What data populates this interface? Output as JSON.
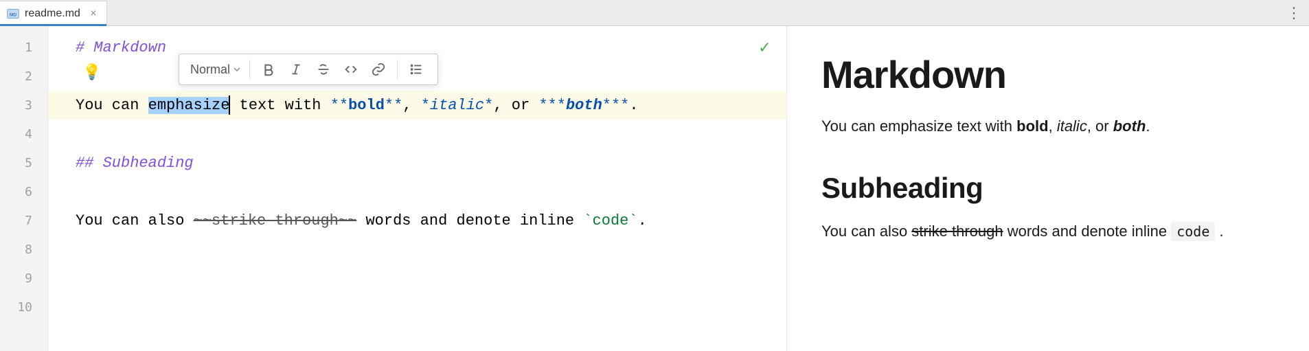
{
  "tab": {
    "filename": "readme.md",
    "icon": "markdown-file-icon"
  },
  "gutter": {
    "lines": [
      "1",
      "2",
      "3",
      "4",
      "5",
      "6",
      "7",
      "8",
      "9",
      "10"
    ]
  },
  "editor": {
    "line1": "# Markdown",
    "line3_prefix": "You can ",
    "line3_selected": "emphasize",
    "line3_mid1": " text with ",
    "line3_bold_sym1": "**",
    "line3_bold_text": "bold",
    "line3_bold_sym2": "**",
    "line3_comma1": ", ",
    "line3_ital_sym1": "*",
    "line3_ital_text": "italic",
    "line3_ital_sym2": "*",
    "line3_comma2": ", or ",
    "line3_both_sym1": "***",
    "line3_both_text": "both",
    "line3_both_sym2": "***",
    "line3_period": ".",
    "line5": "## Subheading",
    "line7_prefix": "You can also ",
    "line7_strike": "~~strike through~~",
    "line7_mid": " words and denote inline ",
    "line7_code": "`code`",
    "line7_period": "."
  },
  "toolbar": {
    "style_label": "Normal"
  },
  "preview": {
    "h1": "Markdown",
    "p1_a": "You can emphasize text with ",
    "p1_bold": "bold",
    "p1_b": ", ",
    "p1_italic": "italic",
    "p1_c": ", or ",
    "p1_both": "both",
    "p1_d": ".",
    "h2": "Subheading",
    "p2_a": "You can also ",
    "p2_strike": "strike through",
    "p2_b": " words and denote inline ",
    "p2_code": "code",
    "p2_c": " ."
  }
}
